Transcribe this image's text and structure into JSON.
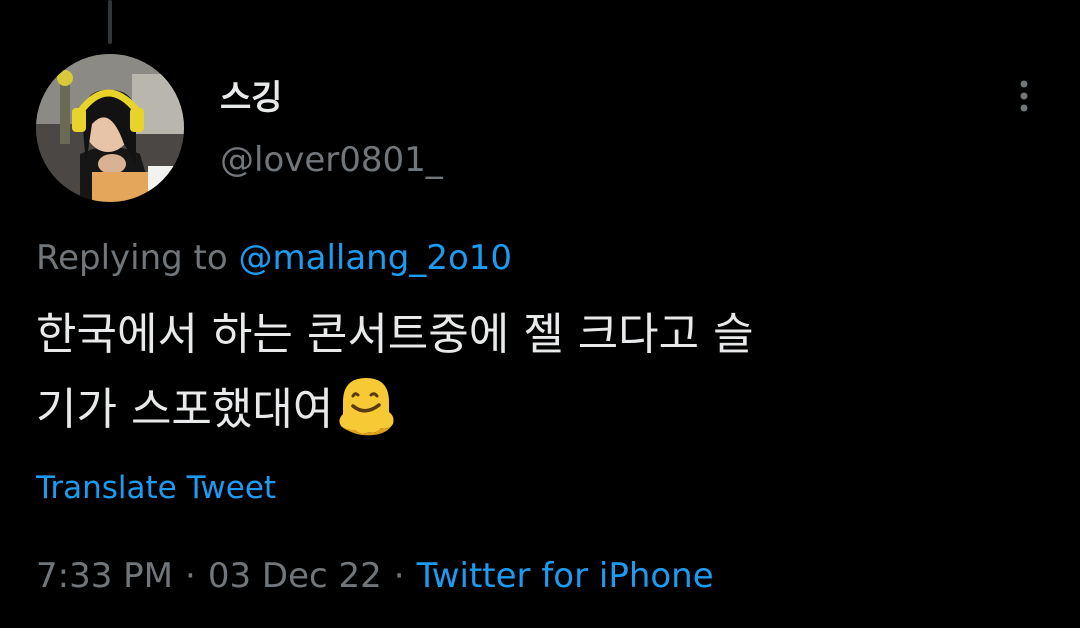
{
  "tweet": {
    "author": {
      "display_name": "스깅",
      "handle": "@lover0801_"
    },
    "replying_to": {
      "prefix": "Replying to",
      "mention": "@mallang_2o10"
    },
    "text_lines": [
      "한국에서 하는 콘서트중에 젤 크다고 슬",
      "기가 스포했대여"
    ],
    "emoji": "melting-face-emoji",
    "translate_label": "Translate Tweet",
    "meta": {
      "time": "7:33 PM",
      "separator": "·",
      "date": "03 Dec 22",
      "source": "Twitter for iPhone"
    }
  },
  "icons": {
    "more": "more-vertical-icon"
  },
  "colors": {
    "background": "#000000",
    "primary_text": "#e7e9ea",
    "secondary_text": "#71767b",
    "link": "#1d9bf0"
  }
}
